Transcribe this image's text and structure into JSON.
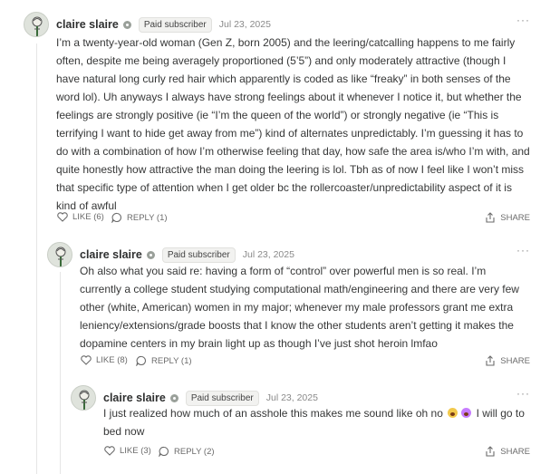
{
  "comments": [
    {
      "author": "claire slaire",
      "badge": "Paid subscriber",
      "date": "Jul 23, 2025",
      "more": "···",
      "text": "I’m a twenty-year-old woman (Gen Z, born 2005) and the leering/catcalling happens to me fairly often, despite me being averagely proportioned (5’5”) and only moderately attractive (though I have natural long curly red hair which apparently is coded as like “freaky” in both senses of the word lol). Uh anyways I always have strong feelings about it whenever I notice it, but whether the feelings are strongly positive (ie “I’m the queen of the world”) or strongly negative (ie “This is terrifying I want to hide get away from me”) kind of alternates unpredictably. I’m guessing it has to do with a combination of how I’m otherwise feeling that day, how safe the area is/who I’m with, and quite honestly how attractive the man doing the leering is lol. Tbh as of now I feel like I won’t miss that specific type of attention when I get older bc the rollercoaster/unpredictability aspect of it is kind of awful",
      "like_label": "LIKE (6)",
      "reply_label": "REPLY (1)",
      "share_label": "SHARE"
    },
    {
      "author": "claire slaire",
      "badge": "Paid subscriber",
      "date": "Jul 23, 2025",
      "more": "···",
      "text": "Oh also what you said re: having a form of “control” over powerful men is so real. I’m currently a college student studying computational math/engineering and there are very few other (white, American) women in my major; whenever my male professors grant me extra leniency/extensions/grade boosts that I know the other students aren’t getting it makes the dopamine centers in my brain light up as though I’ve just shot heroin lmfao",
      "like_label": "LIKE (8)",
      "reply_label": "REPLY (1)",
      "share_label": "SHARE"
    },
    {
      "author": "claire slaire",
      "badge": "Paid subscriber",
      "date": "Jul 23, 2025",
      "more": "···",
      "text_before": "I just realized how much of an asshole this makes me sound like oh no",
      "emoji_names": [
        "distressed-face-emoji",
        "distressed-face-emoji"
      ],
      "text_after": "I will go to bed now",
      "like_label": "LIKE (3)",
      "reply_label": "REPLY (2)",
      "share_label": "SHARE"
    }
  ]
}
